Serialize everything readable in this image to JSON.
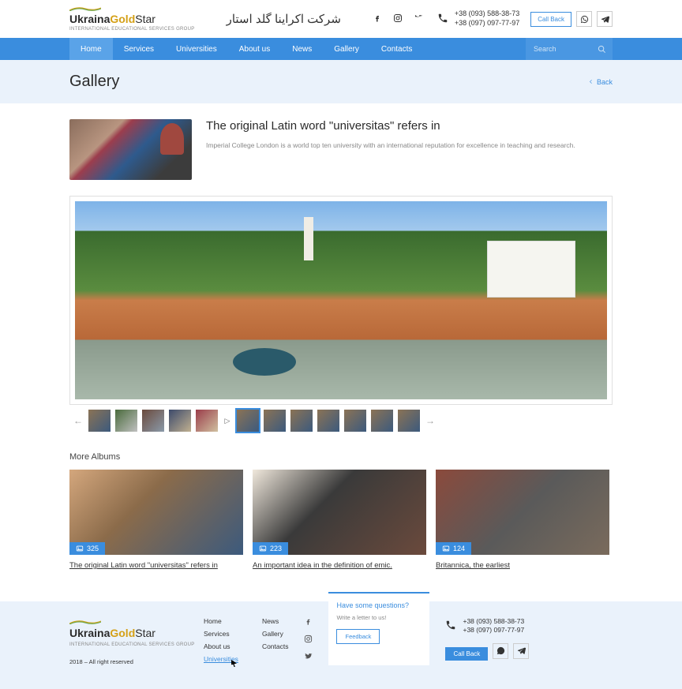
{
  "brand": {
    "ukraina": "Ukraina",
    "gold": "Gold",
    "star": "Star",
    "tagline": "INTERNATIONAL EDUCATIONAL SERVICES GROUP"
  },
  "arabic": "شرکت اکراینا گلد استار",
  "phones": {
    "p1": "+38 (093) 588-38-73",
    "p2": "+38 (097) 097-77-97"
  },
  "callback": "Call Back",
  "nav": {
    "home": "Home",
    "services": "Services",
    "universities": "Universities",
    "about": "About us",
    "news": "News",
    "gallery": "Gallery",
    "contacts": "Contacts"
  },
  "search": {
    "placeholder": "Search"
  },
  "page": {
    "title": "Gallery",
    "back": "Back"
  },
  "intro": {
    "heading": "The original Latin word \"universitas\" refers in",
    "body": "Imperial College London is a world top ten university with an international reputation for excellence in teaching and research."
  },
  "more": {
    "heading": "More Albums"
  },
  "albums": [
    {
      "count": "325",
      "title": "The original Latin word \"universitas\" refers in"
    },
    {
      "count": "223",
      "title": "An important idea in the definition of emic."
    },
    {
      "count": "124",
      "title": "Britannica, the earliest"
    }
  ],
  "footer": {
    "copy": "2018 – All right reserved",
    "nav1": [
      "Home",
      "Services",
      "About us",
      "Universities"
    ],
    "nav2": [
      "News",
      "Gallery",
      "Contacts"
    ],
    "question": {
      "title": "Have some questions?",
      "sub": "Write a letter to us!",
      "btn": "Feedback"
    }
  }
}
